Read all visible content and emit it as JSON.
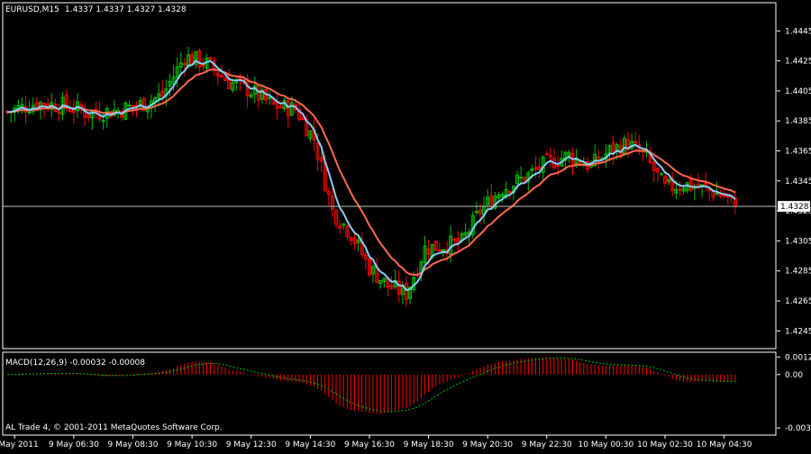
{
  "header": {
    "symbol_label": "EURUSD,M15",
    "ohlc_label": "1.4337 1.4337 1.4327 1.4328"
  },
  "colors": {
    "background": "#000000",
    "frame": "#ffffff",
    "bull": "#00c000",
    "bear": "#ff0000",
    "fast_ma": "#87cefa",
    "slow_ma": "#ff6a4d",
    "macd_hist": "#ff0000",
    "signal": "#00c000",
    "current_price_line": "#c0c0c0",
    "text": "#ffffff"
  },
  "footer": {
    "copyright": "AL Trade 4, © 2001-2011 MetaQuotes Software Corp."
  },
  "chart_data": [
    {
      "type": "candlestick",
      "grid": false,
      "ylim": [
        1.4235,
        1.4462
      ],
      "y_ticks": [
        {
          "value": 1.4445,
          "label": "1.4445"
        },
        {
          "value": 1.4425,
          "label": "1.4425"
        },
        {
          "value": 1.4405,
          "label": "1.4405"
        },
        {
          "value": 1.4385,
          "label": "1.4385"
        },
        {
          "value": 1.4365,
          "label": "1.4365"
        },
        {
          "value": 1.4345,
          "label": "1.4345"
        },
        {
          "value": 1.4325,
          "label": "1.4325"
        },
        {
          "value": 1.4305,
          "label": "1.4305"
        },
        {
          "value": 1.4285,
          "label": "1.4285"
        },
        {
          "value": 1.4265,
          "label": "1.4265"
        },
        {
          "value": 1.4245,
          "label": "1.4245"
        }
      ],
      "current_price": {
        "value": 1.4328,
        "label": "1.4328"
      },
      "x_ticks": [
        {
          "index": 2,
          "label": "9 May 2011"
        },
        {
          "index": 18,
          "label": "9 May 06:30"
        },
        {
          "index": 34,
          "label": "9 May 08:30"
        },
        {
          "index": 50,
          "label": "9 May 10:30"
        },
        {
          "index": 66,
          "label": "9 May 12:30"
        },
        {
          "index": 82,
          "label": "9 May 14:30"
        },
        {
          "index": 98,
          "label": "9 May 16:30"
        },
        {
          "index": 114,
          "label": "9 May 18:30"
        },
        {
          "index": 130,
          "label": "9 May 20:30"
        },
        {
          "index": 146,
          "label": "9 May 22:30"
        },
        {
          "index": 162,
          "label": "10 May 00:30"
        },
        {
          "index": 178,
          "label": "10 May 02:30"
        },
        {
          "index": 194,
          "label": "10 May 04:30"
        }
      ],
      "anchors": [
        {
          "i": 0,
          "close": 1.4391
        },
        {
          "i": 8,
          "close": 1.4397
        },
        {
          "i": 16,
          "close": 1.4395
        },
        {
          "i": 22,
          "close": 1.439
        },
        {
          "i": 30,
          "close": 1.4392
        },
        {
          "i": 36,
          "close": 1.4396
        },
        {
          "i": 42,
          "close": 1.4402
        },
        {
          "i": 48,
          "close": 1.4428
        },
        {
          "i": 54,
          "close": 1.4423
        },
        {
          "i": 60,
          "close": 1.4411
        },
        {
          "i": 66,
          "close": 1.4405
        },
        {
          "i": 72,
          "close": 1.4395
        },
        {
          "i": 78,
          "close": 1.4393
        },
        {
          "i": 83,
          "close": 1.4373
        },
        {
          "i": 88,
          "close": 1.4325
        },
        {
          "i": 93,
          "close": 1.431
        },
        {
          "i": 98,
          "close": 1.4287
        },
        {
          "i": 103,
          "close": 1.4275
        },
        {
          "i": 108,
          "close": 1.427
        },
        {
          "i": 113,
          "close": 1.43
        },
        {
          "i": 118,
          "close": 1.4302
        },
        {
          "i": 123,
          "close": 1.4304
        },
        {
          "i": 128,
          "close": 1.4325
        },
        {
          "i": 134,
          "close": 1.434
        },
        {
          "i": 140,
          "close": 1.4347
        },
        {
          "i": 146,
          "close": 1.4357
        },
        {
          "i": 152,
          "close": 1.4362
        },
        {
          "i": 158,
          "close": 1.4355
        },
        {
          "i": 163,
          "close": 1.4365
        },
        {
          "i": 168,
          "close": 1.437
        },
        {
          "i": 173,
          "close": 1.436
        },
        {
          "i": 178,
          "close": 1.434
        },
        {
          "i": 183,
          "close": 1.4343
        },
        {
          "i": 188,
          "close": 1.434
        },
        {
          "i": 194,
          "close": 1.4335
        },
        {
          "i": 197,
          "close": 1.4328
        }
      ]
    },
    {
      "type": "macd",
      "label": "MACD(12,26,9) -0.00032 -0.00008",
      "ylim": [
        -0.004,
        0.0014
      ],
      "y_ticks": [
        {
          "value": 0.0012,
          "label": "0.0012"
        },
        {
          "value": 0.0,
          "label": "0.00"
        },
        {
          "value": -0.00364,
          "label": "-0.00364"
        }
      ]
    }
  ]
}
